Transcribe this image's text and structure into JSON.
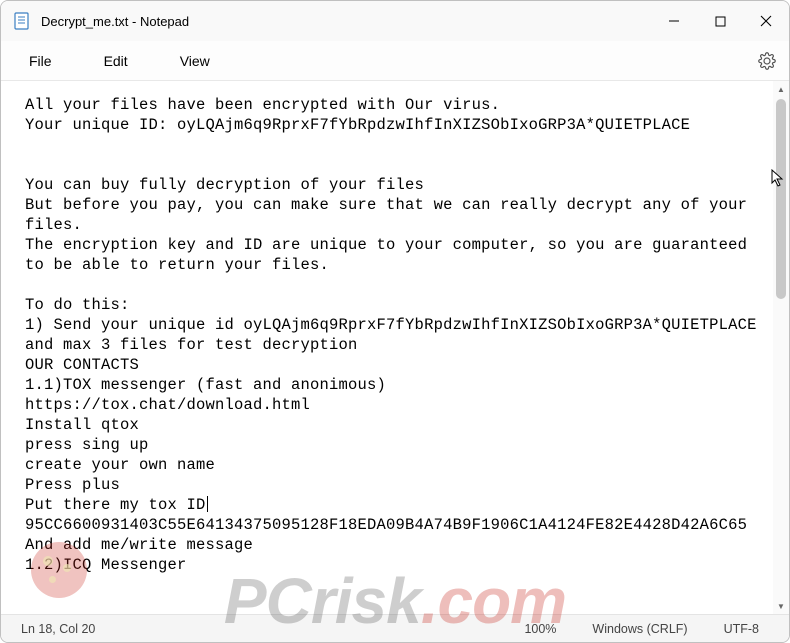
{
  "window": {
    "title": "Decrypt_me.txt - Notepad"
  },
  "menu": {
    "file": "File",
    "edit": "Edit",
    "view": "View"
  },
  "body": {
    "l1": "All your files have been encrypted with Our virus.",
    "l2": "Your unique ID: oyLQAjm6q9RprxF7fYbRpdzwIhfInXIZSObIxoGRP3A*QUIETPLACE",
    "l3": "",
    "l4": "",
    "l5": "You can buy fully decryption of your files",
    "l6": "But before you pay, you can make sure that we can really decrypt any of your files.",
    "l7": "The encryption key and ID are unique to your computer, so you are guaranteed to be able to return your files.",
    "l8": "",
    "l9": "To do this:",
    "l10": "1) Send your unique id oyLQAjm6q9RprxF7fYbRpdzwIhfInXIZSObIxoGRP3A*QUIETPLACE and max 3 files for test decryption",
    "l11": "OUR CONTACTS",
    "l12": "1.1)TOX messenger (fast and anonimous)",
    "l13": "https://tox.chat/download.html",
    "l14": "Install qtox",
    "l15": "press sing up",
    "l16": "create your own name",
    "l17": "Press plus",
    "l18": "Put there my tox ID",
    "l19": "95CC6600931403C55E64134375095128F18EDA09B4A74B9F1906C1A4124FE82E4428D42A6C65",
    "l20": "And add me/write message",
    "l21": "1.2)ICQ Messenger"
  },
  "status": {
    "position": "Ln 18, Col 20",
    "zoom": "100%",
    "eol": "Windows (CRLF)",
    "encoding": "UTF-8"
  },
  "watermark": {
    "prefix": "PC",
    "suffix": "risk",
    "accent": ".com"
  }
}
